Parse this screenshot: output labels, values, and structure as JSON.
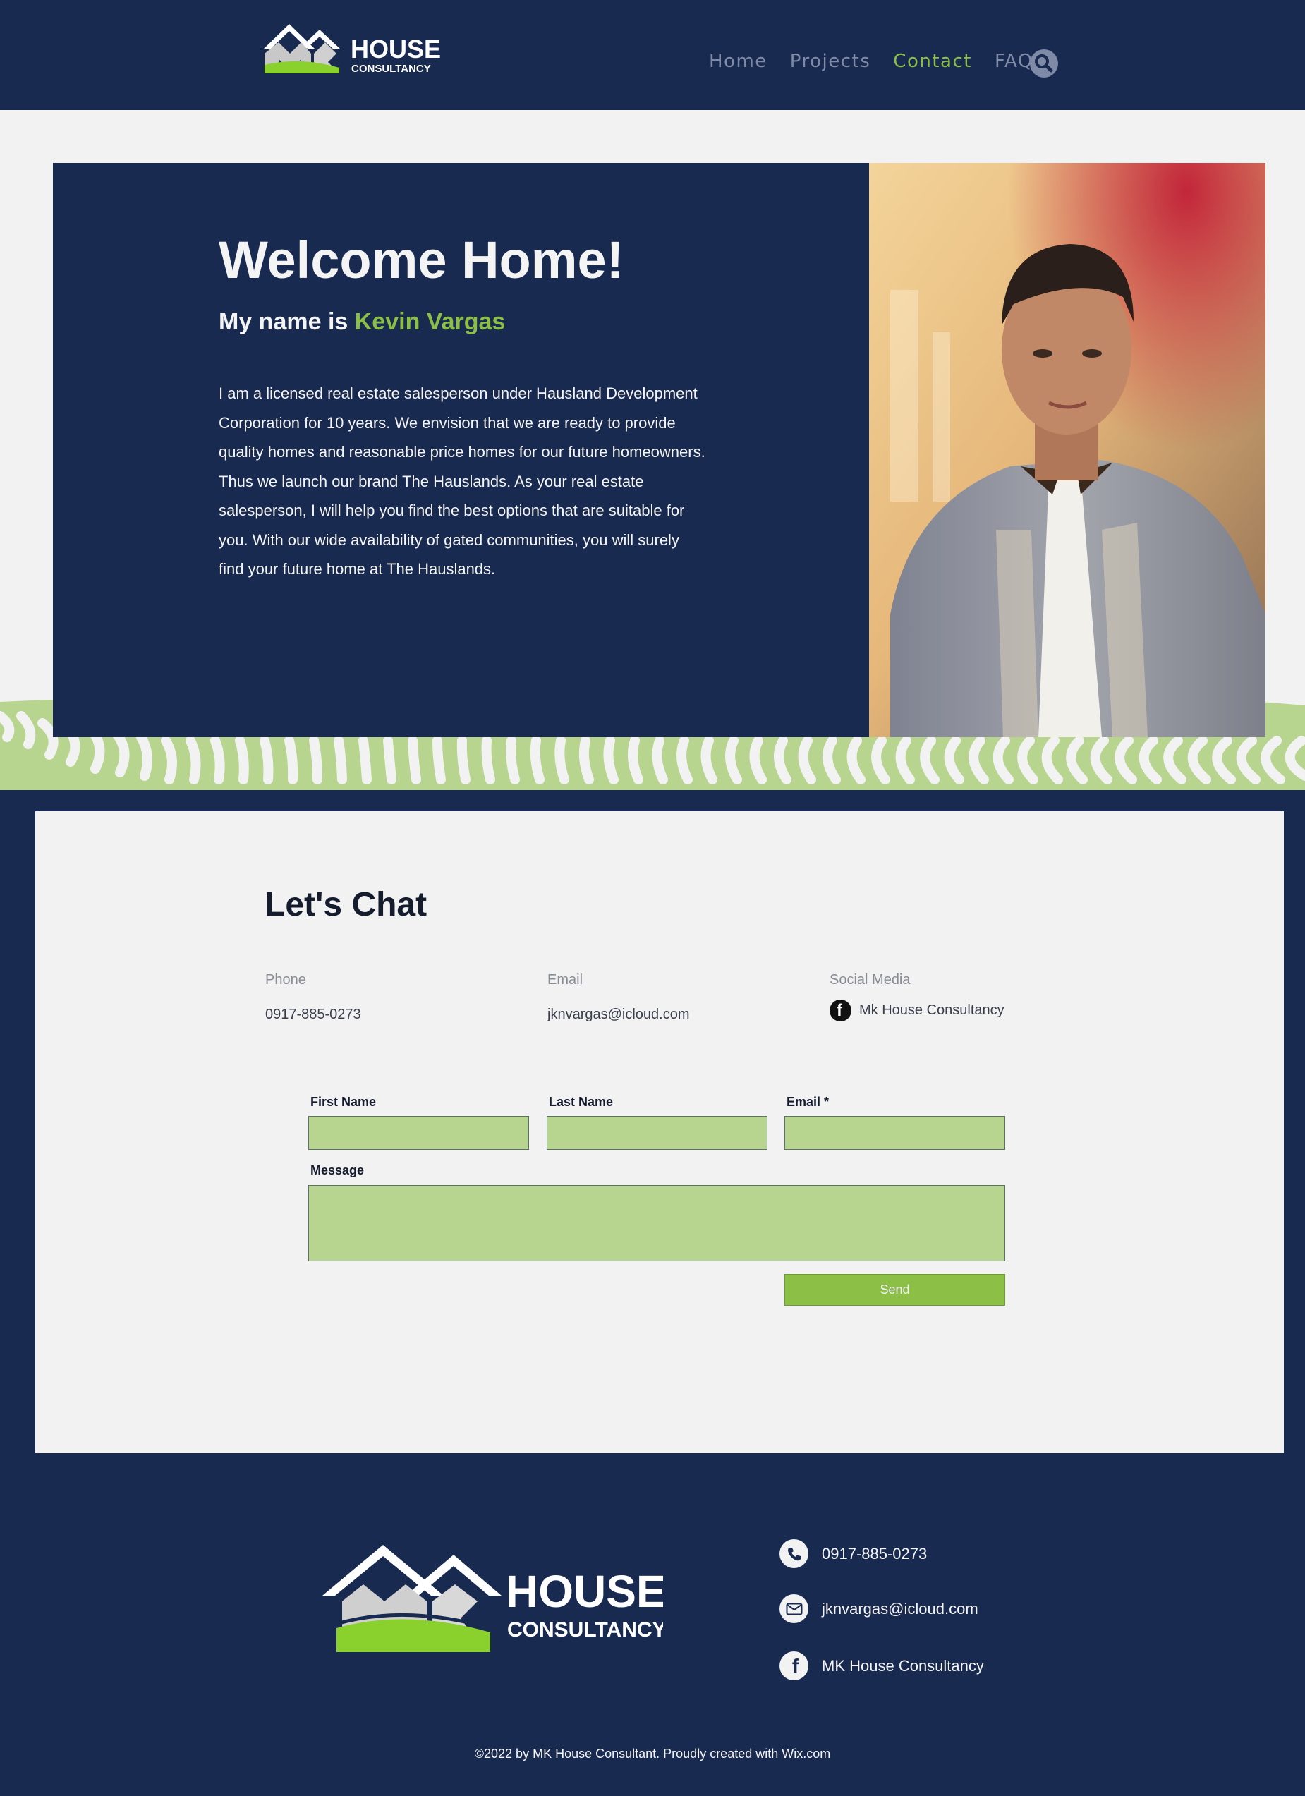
{
  "brand": {
    "logo_text_top": "HOUSE",
    "logo_text_bottom": "CONSULTANCY",
    "logo_mark": "MK"
  },
  "nav": {
    "items": [
      {
        "label": "Home",
        "active": false
      },
      {
        "label": "Projects",
        "active": false
      },
      {
        "label": "Contact",
        "active": true
      },
      {
        "label": "FAQ",
        "active": false
      }
    ],
    "search_icon": "search-icon"
  },
  "hero": {
    "title": "Welcome Home!",
    "subtitle_prefix": "My name is ",
    "subtitle_name": "Kevin Vargas",
    "body": "I am a licensed real estate salesperson under Hausland Development Corporation for 10 years. We envision that we are ready to provide quality homes and reasonable price homes for our future homeowners. Thus we launch our brand The Hauslands. As your real estate salesperson, I will help you find the best options that are suitable for you. With our wide availability of gated communities, you will surely find your future home at The Hauslands."
  },
  "contact": {
    "title": "Let's Chat",
    "phone_label": "Phone",
    "phone_value": "0917-885-0273",
    "email_label": "Email",
    "email_value": "jknvargas@icloud.com",
    "social_label": "Social Media",
    "social_value": "Mk House Consultancy"
  },
  "form": {
    "first_name_label": "First Name",
    "last_name_label": "Last Name",
    "email_label": "Email *",
    "message_label": "Message",
    "first_name_value": "",
    "last_name_value": "",
    "email_value": "",
    "message_value": "",
    "send_label": "Send"
  },
  "footer": {
    "phone": "0917-885-0273",
    "email": "jknvargas@icloud.com",
    "facebook": "MK House Consultancy",
    "copyright_prefix": "©2022 by MK House Consultant. Proudly created with ",
    "copyright_link": "Wix.com"
  },
  "colors": {
    "navy": "#192a51",
    "green": "#8bbf45",
    "light_green": "#b8d58f",
    "light_bg": "#f2f2f2"
  }
}
